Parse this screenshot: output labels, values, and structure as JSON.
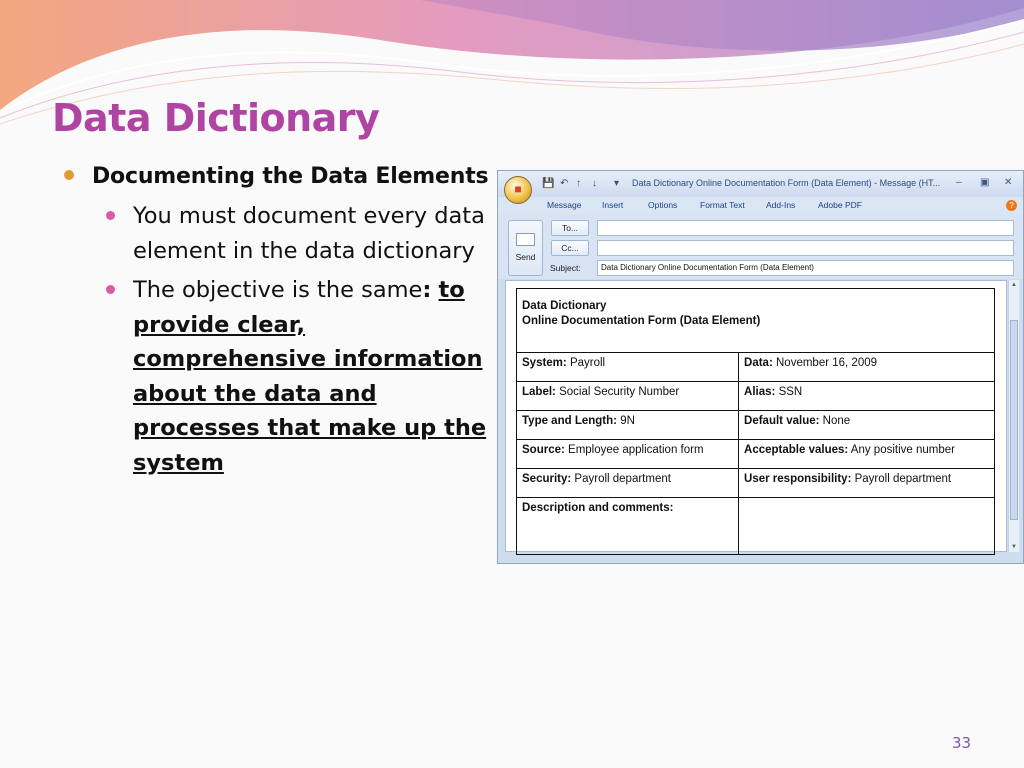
{
  "slide": {
    "title": "Data Dictionary",
    "page_number": "33",
    "accent_color": "#b044a3",
    "bullet_color": "#e29a35"
  },
  "bullets": {
    "level1": "Documenting the Data Elements",
    "item1": "You must document every data element in the data dictionary",
    "item2_prefix": "The objective is the same",
    "item2_colon": ":",
    "item2_emphasis": "to provide clear, comprehensive information about the data and processes that make up the system"
  },
  "window": {
    "title": "Data Dictionary Online Documentation Form (Data Element) - Message (HT...",
    "tabs": [
      "Message",
      "Insert",
      "Options",
      "Format Text",
      "Add-Ins",
      "Adobe PDF"
    ],
    "send_label": "Send",
    "to_label": "To...",
    "cc_label": "Cc...",
    "subject_label": "Subject:",
    "to_value": "",
    "cc_value": "",
    "subject_value": "Data Dictionary Online Documentation Form (Data Element)"
  },
  "form": {
    "heading1": "Data Dictionary",
    "heading2": "Online Documentation Form (Data Element)",
    "rows": [
      {
        "l_label": "System:",
        "l_value": "Payroll",
        "r_label": "Data:",
        "r_value": "November 16, 2009"
      },
      {
        "l_label": "Label:",
        "l_value": "Social Security Number",
        "r_label": "Alias:",
        "r_value": "SSN"
      },
      {
        "l_label": "Type and Length:",
        "l_value": "9N",
        "r_label": "Default value:",
        "r_value": "None"
      },
      {
        "l_label": "Source:",
        "l_value": "Employee application form",
        "r_label": "Acceptable values:",
        "r_value": "Any positive number"
      },
      {
        "l_label": "Security:",
        "l_value": "Payroll department",
        "r_label": "User responsibility:",
        "r_value": "Payroll department"
      }
    ],
    "desc_label": "Description and comments:"
  }
}
